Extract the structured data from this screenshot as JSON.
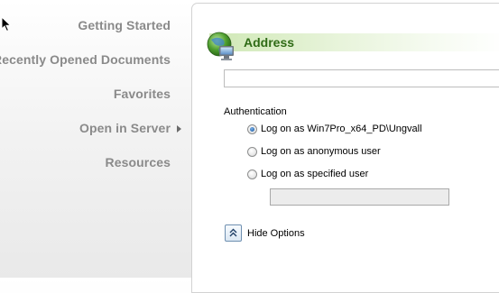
{
  "nav": {
    "items": [
      {
        "label": "Getting Started"
      },
      {
        "label": "Recently Opened Documents"
      },
      {
        "label": "Favorites"
      },
      {
        "label": "Open in Server"
      },
      {
        "label": "Resources"
      }
    ]
  },
  "address": {
    "title": "Address",
    "value": "",
    "authentication_label": "Authentication",
    "options": [
      {
        "label": "Log on as Win7Pro_x64_PD\\Ungvall",
        "selected": true
      },
      {
        "label": "Log on as anonymous user",
        "selected": false
      },
      {
        "label": "Log on as specified user",
        "selected": false
      }
    ],
    "specified_user_value": "",
    "hide_options_label": "Hide Options"
  },
  "colors": {
    "nav_text": "#8a8a8a",
    "section_title": "#2f6b16",
    "header_bar": "#cfe8b5"
  },
  "icons": {
    "cursor": "mouse-pointer-icon",
    "globe": "network-globe-icon",
    "submenu": "chevron-right-icon",
    "hide": "double-chevron-up-icon"
  }
}
